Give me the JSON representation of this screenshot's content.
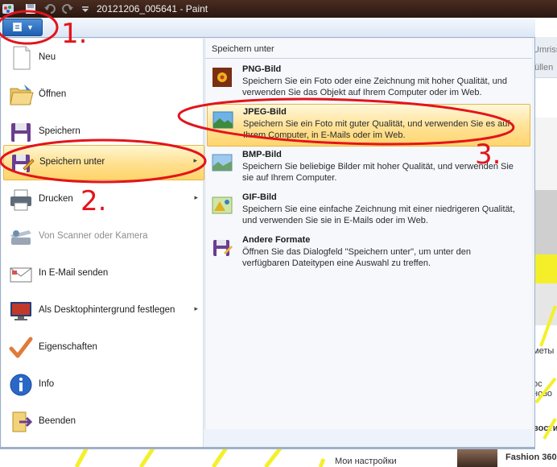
{
  "window": {
    "title": "20121206_005641 - Paint"
  },
  "app_menu": {
    "left_items": [
      {
        "label": "Neu",
        "submenu": false,
        "disabled": false
      },
      {
        "label": "Öffnen",
        "submenu": false,
        "disabled": false
      },
      {
        "label": "Speichern",
        "submenu": false,
        "disabled": false
      },
      {
        "label": "Speichern unter",
        "submenu": true,
        "disabled": false,
        "highlighted": true
      },
      {
        "label": "Drucken",
        "submenu": true,
        "disabled": false
      },
      {
        "label": "Von Scanner oder Kamera",
        "submenu": false,
        "disabled": true
      },
      {
        "label": "In E-Mail senden",
        "submenu": false,
        "disabled": false
      },
      {
        "label": "Als Desktophintergrund festlegen",
        "submenu": true,
        "disabled": false
      },
      {
        "label": "Eigenschaften",
        "submenu": false,
        "disabled": false
      },
      {
        "label": "Info",
        "submenu": false,
        "disabled": false
      },
      {
        "label": "Beenden",
        "submenu": false,
        "disabled": false
      }
    ],
    "submenu_arrow": "▸",
    "right_panel": {
      "header": "Speichern unter",
      "items": [
        {
          "title": "PNG-Bild",
          "description": "Speichern Sie ein Foto oder eine Zeichnung mit hoher Qualität, und verwenden Sie das Objekt auf Ihrem Computer oder im Web."
        },
        {
          "title": "JPEG-Bild",
          "description": "Speichern Sie ein Foto mit guter Qualität, und verwenden Sie es auf Ihrem Computer, in E-Mails oder im Web.",
          "highlighted": true
        },
        {
          "title": "BMP-Bild",
          "description": "Speichern Sie beliebige Bilder mit hoher Qualität, und verwenden Sie sie auf Ihrem Computer."
        },
        {
          "title": "GIF-Bild",
          "description": "Speichern Sie eine einfache Zeichnung mit einer niedrigeren Qualität, und verwenden Sie sie in E-Mails oder im Web."
        },
        {
          "title": "Andere Formate",
          "description": "Öffnen Sie das Dialogfeld \"Speichern unter\", um unter den verfügbaren Dateitypen eine Auswahl zu treffen."
        }
      ]
    }
  },
  "annotations": {
    "step1": "1.",
    "step2": "2.",
    "step3": "3.",
    "color": "#e3141b"
  },
  "background_page": {
    "fragments": [
      "Umriss",
      "üllen",
      "меты",
      "ос ново",
      "вости",
      "Fashion 360",
      "Мои настройки"
    ]
  }
}
